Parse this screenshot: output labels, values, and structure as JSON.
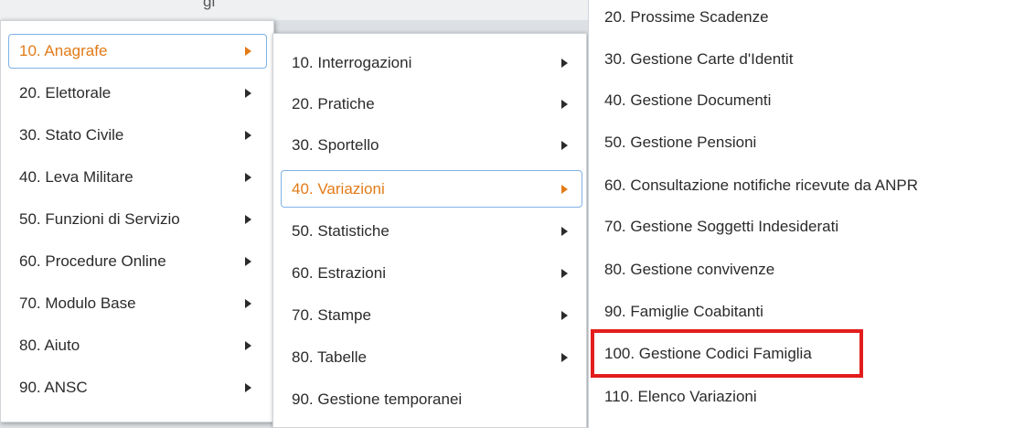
{
  "top_partial_text": "gi",
  "menu1": {
    "items": [
      {
        "label": "10. Anagrafe",
        "active": true
      },
      {
        "label": "20. Elettorale"
      },
      {
        "label": "30. Stato Civile"
      },
      {
        "label": "40. Leva Militare"
      },
      {
        "label": "50. Funzioni di Servizio"
      },
      {
        "label": "60. Procedure Online"
      },
      {
        "label": "70. Modulo Base"
      },
      {
        "label": "80. Aiuto"
      },
      {
        "label": "90. ANSC"
      }
    ]
  },
  "menu2": {
    "items": [
      {
        "label": "10. Interrogazioni"
      },
      {
        "label": "20. Pratiche"
      },
      {
        "label": "30. Sportello"
      },
      {
        "label": "40. Variazioni",
        "active": true
      },
      {
        "label": "50. Statistiche"
      },
      {
        "label": "60. Estrazioni"
      },
      {
        "label": "70. Stampe"
      },
      {
        "label": "80. Tabelle"
      },
      {
        "label": "90. Gestione temporanei"
      }
    ]
  },
  "menu3": {
    "items": [
      {
        "label": "20. Prossime Scadenze"
      },
      {
        "label": "30. Gestione Carte d'Identit"
      },
      {
        "label": "40. Gestione Documenti"
      },
      {
        "label": "50. Gestione Pensioni"
      },
      {
        "label": "60. Consultazione notifiche ricevute da ANPR"
      },
      {
        "label": "70. Gestione Soggetti Indesiderati"
      },
      {
        "label": "80. Gestione convivenze"
      },
      {
        "label": "90. Famiglie Coabitanti"
      },
      {
        "label": "100. Gestione Codici Famiglia",
        "highlighted": true
      },
      {
        "label": "110. Elenco Variazioni"
      }
    ]
  },
  "colors": {
    "active_text": "#e27b17",
    "active_border": "#7eb2e6",
    "highlight_box": "#e31d1d"
  }
}
